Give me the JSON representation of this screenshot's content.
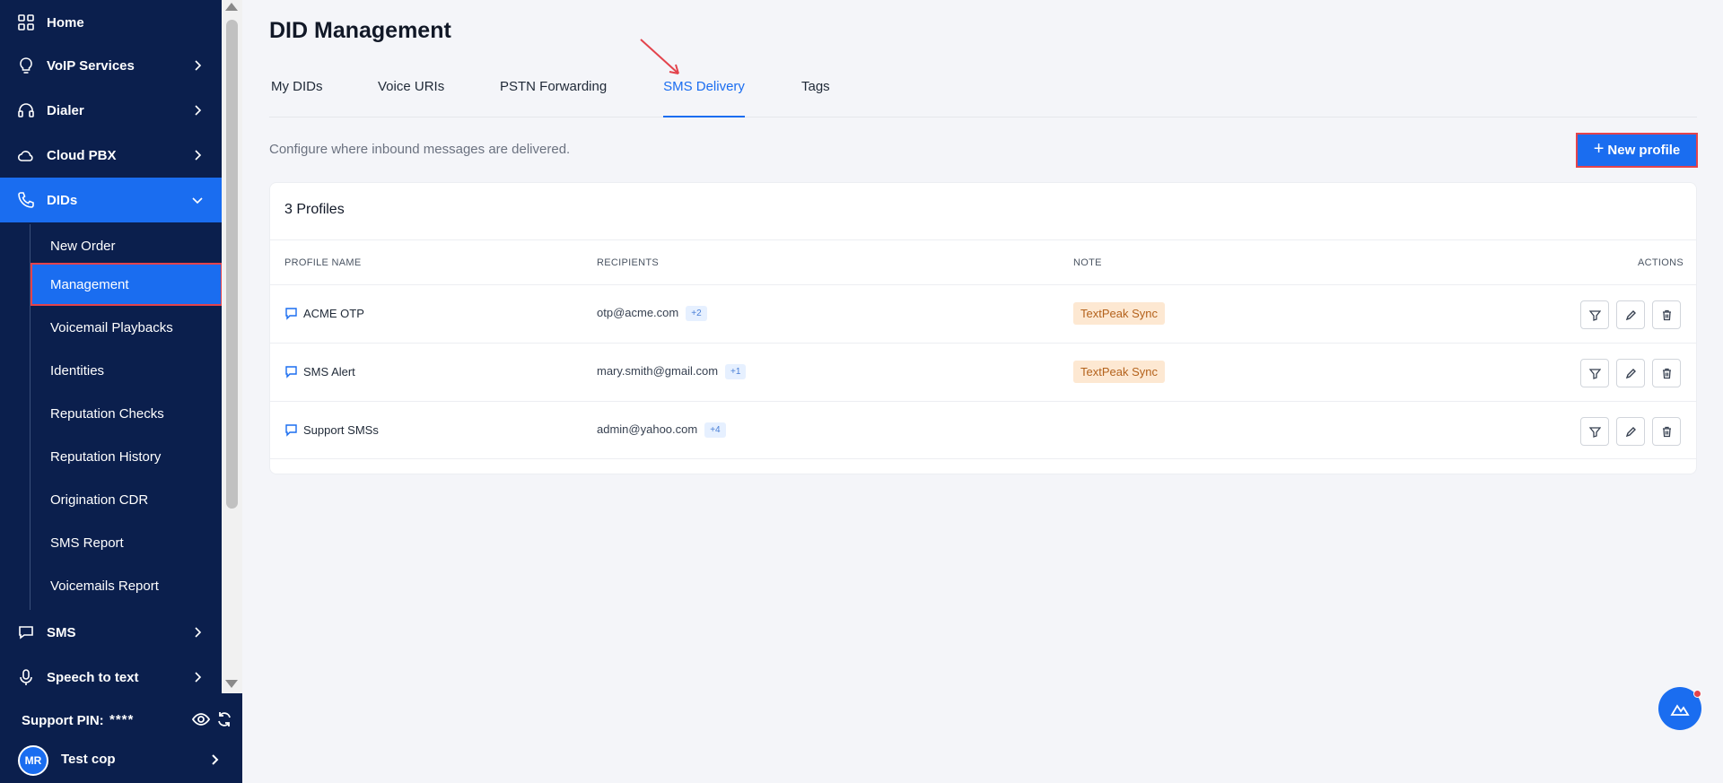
{
  "sidebar": {
    "items": [
      {
        "label": "Home",
        "icon": "grid-icon"
      },
      {
        "label": "VoIP Services",
        "icon": "bulb-icon"
      },
      {
        "label": "Dialer",
        "icon": "headset-icon"
      },
      {
        "label": "Cloud PBX",
        "icon": "cloud-icon"
      },
      {
        "label": "DIDs",
        "icon": "phone-icon"
      },
      {
        "label": "SMS",
        "icon": "chat-icon"
      },
      {
        "label": "Speech to text",
        "icon": "microphone-icon"
      }
    ],
    "sub_items": [
      {
        "label": "New Order"
      },
      {
        "label": "Management"
      },
      {
        "label": "Voicemail Playbacks"
      },
      {
        "label": "Identities"
      },
      {
        "label": "Reputation Checks"
      },
      {
        "label": "Reputation History"
      },
      {
        "label": "Origination CDR"
      },
      {
        "label": "SMS Report"
      },
      {
        "label": "Voicemails Report"
      }
    ],
    "footer": {
      "pin_label": "Support PIN:",
      "pin_value": "****",
      "avatar_initials": "MR",
      "user_name": "Test cop"
    }
  },
  "page": {
    "title": "DID Management",
    "subtitle": "Configure where inbound messages are delivered.",
    "new_button": "New profile",
    "new_button_plus": "+"
  },
  "tabs": [
    {
      "label": "My DIDs"
    },
    {
      "label": "Voice URIs"
    },
    {
      "label": "PSTN Forwarding"
    },
    {
      "label": "SMS Delivery"
    },
    {
      "label": "Tags"
    }
  ],
  "table": {
    "title": "3 Profiles",
    "headers": {
      "name": "PROFILE NAME",
      "recipients": "RECIPIENTS",
      "note": "NOTE",
      "actions": "ACTIONS"
    },
    "rows": [
      {
        "name": "ACME OTP",
        "recipient": "otp@acme.com",
        "extra": "+2",
        "note": "TextPeak Sync"
      },
      {
        "name": "SMS Alert",
        "recipient": "mary.smith@gmail.com",
        "extra": "+1",
        "note": "TextPeak Sync"
      },
      {
        "name": "Support SMSs",
        "recipient": "admin@yahoo.com",
        "extra": "+4",
        "note": ""
      }
    ]
  },
  "colors": {
    "sidebar_bg": "#0b1f4d",
    "accent": "#1a6df0",
    "highlight_border": "#e3434c",
    "note_badge_bg": "#fde8d2"
  }
}
